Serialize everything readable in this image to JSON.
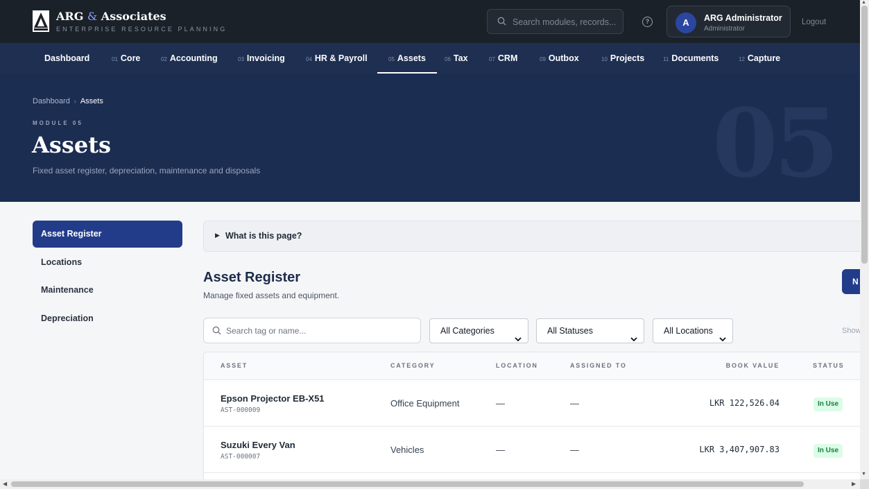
{
  "brand": {
    "name_a": "ARG",
    "name_amp": "&",
    "name_b": "Associates",
    "subtitle": "ENTERPRISE RESOURCE PLANNING"
  },
  "header": {
    "search_placeholder": "Search modules, records...",
    "help_icon": "?",
    "user_initial": "A",
    "user_name": "ARG Administrator",
    "user_role": "Administrator",
    "logout": "Logout"
  },
  "nav": {
    "items": [
      {
        "num": "",
        "label": "Dashboard"
      },
      {
        "num": "01",
        "label": "Core"
      },
      {
        "num": "02",
        "label": "Accounting"
      },
      {
        "num": "03",
        "label": "Invoicing"
      },
      {
        "num": "04",
        "label": "HR & Payroll"
      },
      {
        "num": "05",
        "label": "Assets"
      },
      {
        "num": "06",
        "label": "Tax"
      },
      {
        "num": "07",
        "label": "CRM"
      },
      {
        "num": "09",
        "label": "Outbox"
      },
      {
        "num": "10",
        "label": "Projects"
      },
      {
        "num": "11",
        "label": "Documents"
      },
      {
        "num": "12",
        "label": "Capture"
      }
    ],
    "active": "Assets"
  },
  "hero": {
    "breadcrumb": [
      "Dashboard",
      "Assets"
    ],
    "eyebrow": "MODULE 05",
    "title": "Assets",
    "description": "Fixed asset register, depreciation, maintenance and disposals",
    "big_number": "05"
  },
  "sidebar": {
    "items": [
      "Asset Register",
      "Locations",
      "Maintenance",
      "Depreciation"
    ],
    "active": "Asset Register"
  },
  "main": {
    "help_toggle": "What is this page?",
    "title": "Asset Register",
    "subtitle": "Manage fixed assets and equipment.",
    "new_button": "N",
    "search_placeholder": "Search tag or name...",
    "filters": {
      "category": "All Categories",
      "status": "All Statuses",
      "location": "All Locations"
    },
    "show_label": "Show",
    "columns": [
      "ASSET",
      "CATEGORY",
      "LOCATION",
      "ASSIGNED TO",
      "BOOK VALUE",
      "STATUS"
    ],
    "rows": [
      {
        "name": "Epson Projector EB-X51",
        "tag": "AST-000009",
        "category": "Office Equipment",
        "location": "—",
        "assigned_to": "—",
        "book_value": "LKR 122,526.04",
        "status": "In Use"
      },
      {
        "name": "Suzuki Every Van",
        "tag": "AST-000007",
        "category": "Vehicles",
        "location": "—",
        "assigned_to": "—",
        "book_value": "LKR 3,407,907.83",
        "status": "In Use"
      }
    ]
  },
  "colors": {
    "topbar": "#1b2129",
    "nav": "#1e2f52",
    "hero": "#1c2d52",
    "accent": "#223c8a",
    "status_green": "#15803d"
  }
}
